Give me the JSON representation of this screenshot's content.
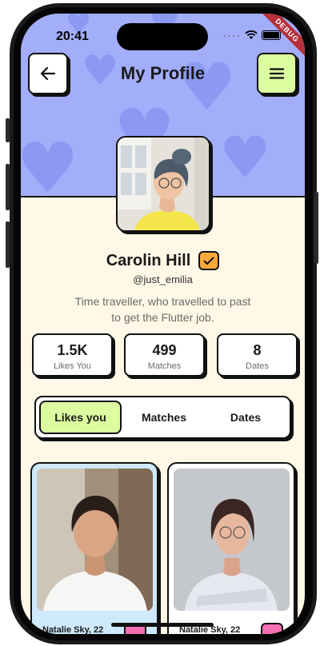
{
  "status_bar": {
    "time": "20:41",
    "debug_banner": "DEBUG"
  },
  "header": {
    "title": "My Profile",
    "back_icon": "arrow-left-icon",
    "menu_icon": "hamburger-menu-icon"
  },
  "colors": {
    "header_bg": "#a3aefb",
    "accent_green": "#dcfca0",
    "verified_orange": "#f8a93c",
    "page_bg": "#fff8e6",
    "heart_pink": "#f26fb0"
  },
  "profile": {
    "name": "Carolin Hill",
    "handle": "@just_emilia",
    "bio": "Time traveller, who travelled to past to get the Flutter job.",
    "verified_icon": "check-icon"
  },
  "stats": [
    {
      "value": "1.5K",
      "label": "Likes You"
    },
    {
      "value": "499",
      "label": "Matches"
    },
    {
      "value": "8",
      "label": "Dates"
    }
  ],
  "tabs": [
    {
      "label": "Likes you",
      "active": true
    },
    {
      "label": "Matches",
      "active": false
    },
    {
      "label": "Dates",
      "active": false
    }
  ],
  "cards": [
    {
      "name": "Natalie Sky, 22"
    },
    {
      "name": "Natalie Sky, 22"
    }
  ]
}
